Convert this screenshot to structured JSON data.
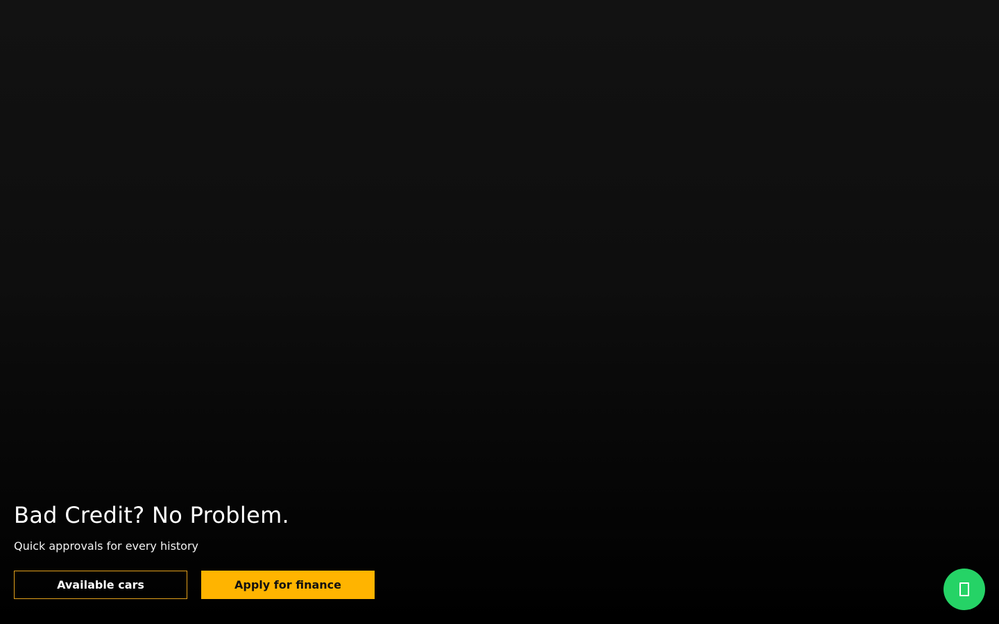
{
  "hero": {
    "title": "Bad Credit? No Problem.",
    "subtitle": "Quick approvals for every history"
  },
  "cta": {
    "available_cars_label": "Available cars",
    "apply_finance_label": "Apply for finance"
  },
  "floating_button": {
    "icon": "whatsapp-icon"
  },
  "colors": {
    "accent": "#ffb400",
    "outline_border": "#e4a11b",
    "whatsapp_green": "#25d366",
    "background": "#0e0e0e"
  }
}
